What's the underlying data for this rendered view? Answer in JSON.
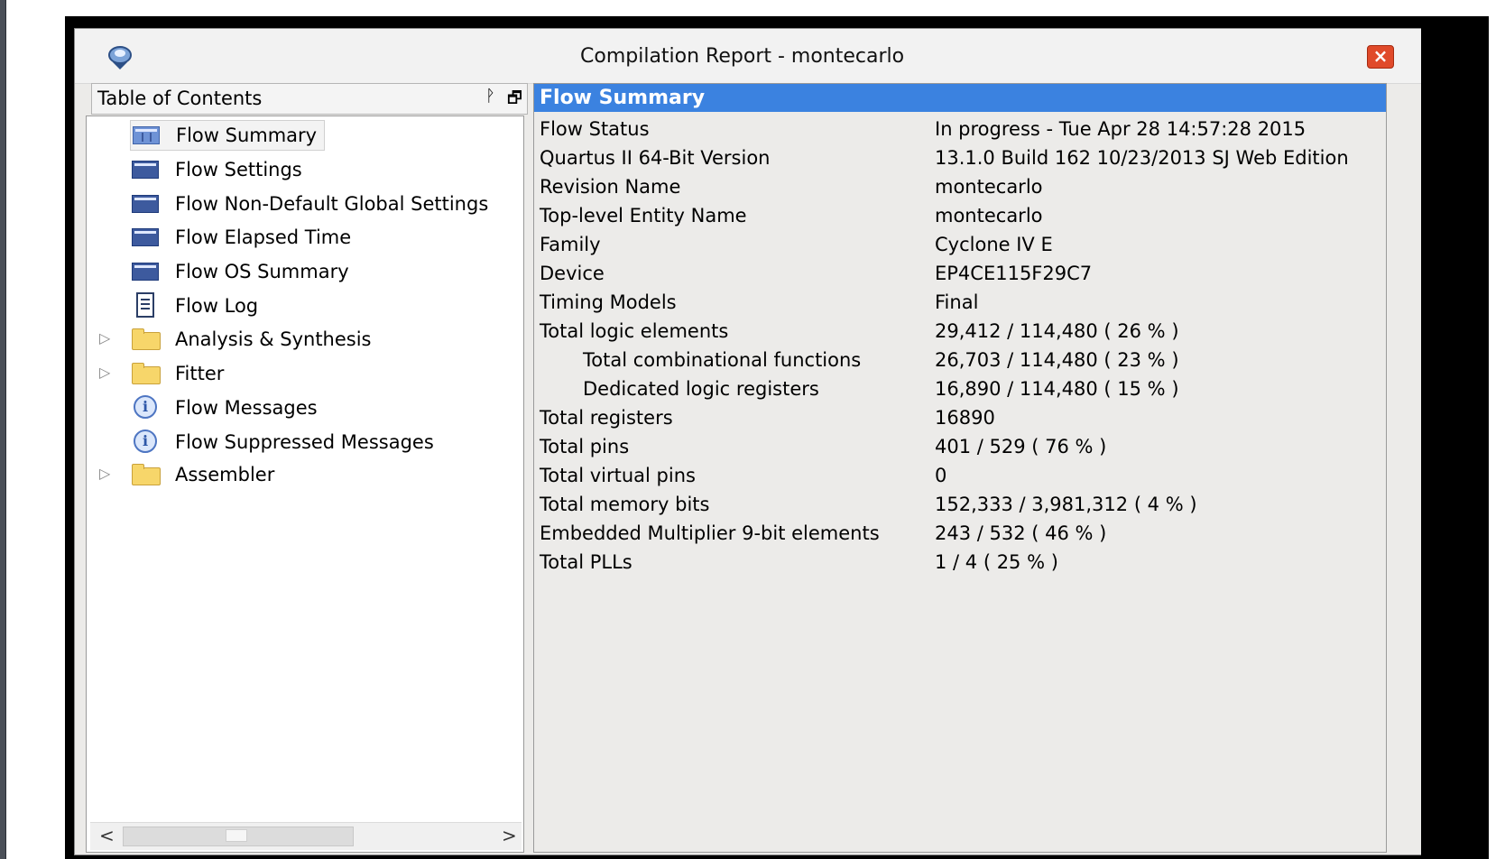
{
  "window": {
    "title": "Compilation Report - montecarlo",
    "close_label": "×"
  },
  "toc": {
    "title": "Table of Contents",
    "pin_label": "ᚹ",
    "float_label": "🗗",
    "items": [
      {
        "label": "Flow Summary",
        "icon": "table-icon",
        "selected": true
      },
      {
        "label": "Flow Settings",
        "icon": "table-icon"
      },
      {
        "label": "Flow Non-Default Global Settings",
        "icon": "table-icon"
      },
      {
        "label": "Flow Elapsed Time",
        "icon": "table-icon"
      },
      {
        "label": "Flow OS Summary",
        "icon": "table-icon"
      },
      {
        "label": "Flow Log",
        "icon": "document-icon"
      },
      {
        "label": "Analysis & Synthesis",
        "icon": "folder-icon",
        "expandable": true
      },
      {
        "label": "Fitter",
        "icon": "folder-icon",
        "expandable": true
      },
      {
        "label": "Flow Messages",
        "icon": "info-icon"
      },
      {
        "label": "Flow Suppressed Messages",
        "icon": "info-icon"
      },
      {
        "label": "Assembler",
        "icon": "folder-icon",
        "expandable": true
      }
    ],
    "expander_glyph": "▷",
    "scroll_left": "<",
    "scroll_right": ">"
  },
  "summary": {
    "title": "Flow Summary",
    "rows": [
      {
        "key": "Flow Status",
        "value": "In progress - Tue Apr 28 14:57:28 2015"
      },
      {
        "key": "Quartus II 64-Bit Version",
        "value": "13.1.0 Build 162 10/23/2013 SJ Web Edition"
      },
      {
        "key": "Revision Name",
        "value": "montecarlo"
      },
      {
        "key": "Top-level Entity Name",
        "value": "montecarlo"
      },
      {
        "key": "Family",
        "value": "Cyclone IV E"
      },
      {
        "key": "Device",
        "value": "EP4CE115F29C7"
      },
      {
        "key": "Timing Models",
        "value": "Final"
      },
      {
        "key": "Total logic elements",
        "value": "29,412 / 114,480 ( 26 % )"
      },
      {
        "key": "Total combinational functions",
        "value": "26,703 / 114,480 ( 23 % )",
        "indent": true
      },
      {
        "key": "Dedicated logic registers",
        "value": "16,890 / 114,480 ( 15 % )",
        "indent": true
      },
      {
        "key": "Total registers",
        "value": "16890"
      },
      {
        "key": "Total pins",
        "value": "401 / 529 ( 76 % )"
      },
      {
        "key": "Total virtual pins",
        "value": "0"
      },
      {
        "key": "Total memory bits",
        "value": "152,333 / 3,981,312 ( 4 % )"
      },
      {
        "key": "Embedded Multiplier 9-bit elements",
        "value": "243 / 532 ( 46 % )"
      },
      {
        "key": "Total PLLs",
        "value": "1 / 4 ( 25 % )"
      }
    ]
  },
  "colors": {
    "header_blue": "#3b82e0",
    "close_red": "#e04a2a"
  }
}
